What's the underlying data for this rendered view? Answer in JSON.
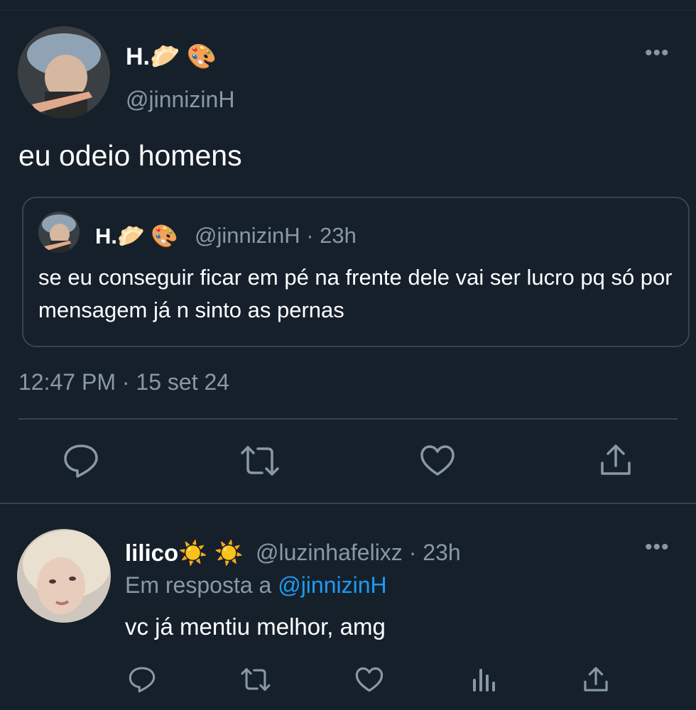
{
  "tweet": {
    "author_name": "H.🥟 🎨",
    "author_handle": "@jinnizinH",
    "more_label": "•••",
    "text": "eu odeio homens",
    "timestamp": "12:47 PM · 15 set 24",
    "quoted": {
      "author_name": "H.🥟 🎨",
      "meta": "@jinnizinH · 23h",
      "text": "se eu conseguir ficar em pé na frente dele vai ser lucro pq só por mensagem já n sinto as pernas"
    },
    "actions": [
      "reply-icon",
      "retweet-icon",
      "like-icon",
      "share-icon"
    ]
  },
  "reply": {
    "author_name": "lilico☀️ ☀️",
    "meta": "@luzinhafelixz · 23h",
    "replying_prefix": "Em resposta a ",
    "replying_to": "@jinnizinH",
    "text": "vc já mentiu melhor, amg",
    "more_label": "•••",
    "actions": [
      "reply-icon",
      "retweet-icon",
      "like-icon",
      "analytics-icon",
      "share-icon"
    ]
  },
  "colors": {
    "background": "#15202b",
    "secondary_text": "#8899a6",
    "border": "#38444d",
    "accent": "#1d9bf0"
  }
}
